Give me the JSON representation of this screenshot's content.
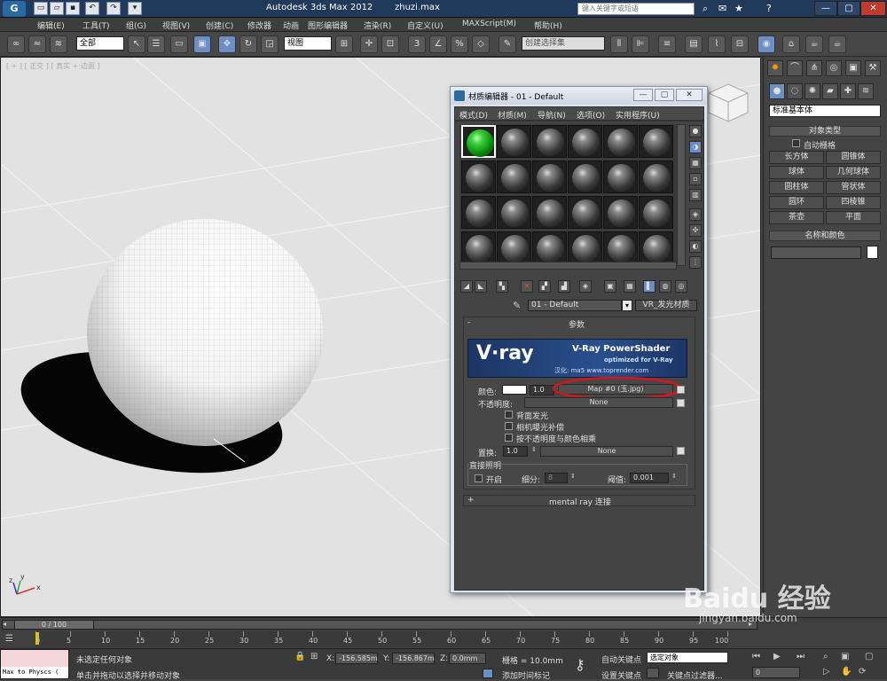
{
  "titlebar": {
    "title": "Autodesk 3ds Max  2012",
    "file_suffix": "zhuzi.max",
    "search_placeholder": "键入关键字或短语",
    "win_min": "—",
    "win_max": "▢",
    "win_close": "✕"
  },
  "menus": [
    "编辑(E)",
    "工具(T)",
    "组(G)",
    "视图(V)",
    "创建(C)",
    "修改器",
    "动画",
    "图形编辑器",
    "渲染(R)",
    "自定义(U)",
    "MAXScript(M)",
    "帮助(H)"
  ],
  "toolbar": {
    "selection_filter": "全部",
    "ref_coord": "视图",
    "named_sel": "创建选择集"
  },
  "viewport": {
    "label": "[ + ] [ 正交 ] [ 真实 + 边面 ]",
    "axis_x": "x",
    "axis_y": "y",
    "axis_z": "z"
  },
  "material_editor": {
    "title": "材质编辑器 - 01 - Default",
    "menu": [
      "模式(D)",
      "材质(M)",
      "导航(N)",
      "选项(O)",
      "实用程序(U)"
    ],
    "material_name": "01 - Default",
    "material_type": "VR_发光材质",
    "params_header": "参数",
    "banner_logo": "V·ray",
    "banner_title": "V-Ray PowerShader",
    "banner_sub": "optimized for V-Ray",
    "banner_credit": "汉化: ma5  www.toprender.com",
    "color_label": "颜色:",
    "color_value": "1.0",
    "color_map": "Map #0 (玉.jpg)",
    "opacity_label": "不透明度:",
    "opacity_map": "None",
    "opt_backside": "背面发光",
    "opt_exposure": "相机曝光补偿",
    "opt_multiply": "按不透明度与颜色相乘",
    "displace_label": "置换:",
    "displace_value": "1.0",
    "displace_map": "None",
    "direct_header": "直接照明",
    "direct_on": "开启",
    "subdivs_label": "细分:",
    "subdivs_value": "8",
    "threshold_label": "阈值:",
    "threshold_value": "0.001",
    "mental_ray": "mental ray 连接",
    "plus": "+",
    "minus": "-"
  },
  "cmdpanel": {
    "category": "标准基本体",
    "object_type_header": "对象类型",
    "autogrid": "自动栅格",
    "buttons": [
      "长方体",
      "圆锥体",
      "球体",
      "几何球体",
      "圆柱体",
      "管状体",
      "圆环",
      "四棱锥",
      "茶壶",
      "平面"
    ],
    "name_color_header": "名称和颜色"
  },
  "timeline": {
    "frame": "0 / 100",
    "ticks": [
      "0",
      "5",
      "10",
      "15",
      "20",
      "25",
      "30",
      "35",
      "40",
      "45",
      "50",
      "55",
      "60",
      "65",
      "70",
      "75",
      "80",
      "85",
      "90",
      "95",
      "100"
    ]
  },
  "status": {
    "maxscript": "Max to Physcs (",
    "no_selection": "未选定任何对象",
    "prompt": "单击并拖动以选择并移动对象",
    "x_label": "X:",
    "x_value": "-156.585m",
    "y_label": "Y:",
    "y_value": "-156.867m",
    "z_label": "Z:",
    "z_value": "0.0mm",
    "grid": "栅格 = 10.0mm",
    "add_time_tag": "添加时间标记",
    "auto_key": "自动关键点",
    "set_key": "设置关键点",
    "selected_obj": "选定对象",
    "key_filters": "关键点过滤器...",
    "frame_field": "0",
    "watermark": "Baidu 经验",
    "watermark_url": "jingyan.baidu.com"
  }
}
